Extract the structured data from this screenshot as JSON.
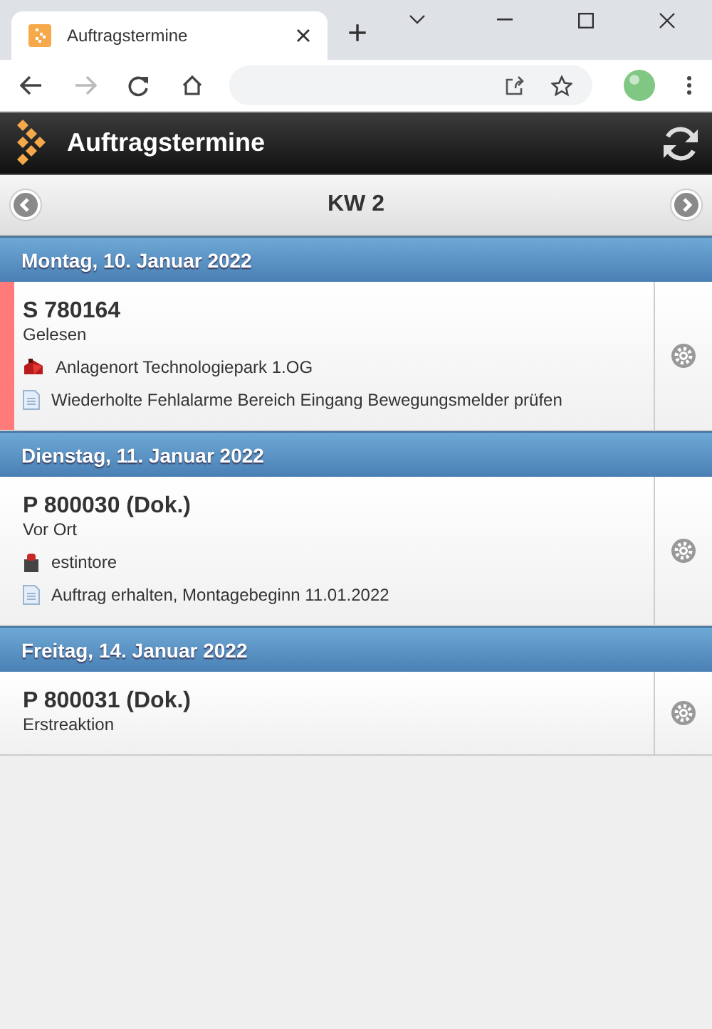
{
  "browser": {
    "tab_title": "Auftragstermine",
    "new_tab": "+"
  },
  "app": {
    "title": "Auftragstermine"
  },
  "week": {
    "label": "KW 2"
  },
  "days": [
    {
      "date": "Montag, 10. Januar 2022",
      "entries": [
        {
          "number": "S 780164",
          "status": "Gelesen",
          "flagged": true,
          "details": [
            {
              "kind": "location",
              "text": "Anlagenort Technologiepark 1.OG"
            },
            {
              "kind": "note",
              "text": "Wiederholte Fehlalarme Bereich Eingang Bewegungsmelder prüfen"
            }
          ]
        }
      ]
    },
    {
      "date": "Dienstag, 11. Januar 2022",
      "entries": [
        {
          "number": "P 800030 (Dok.)",
          "status": "Vor Ort",
          "flagged": false,
          "details": [
            {
              "kind": "device",
              "text": "estintore"
            },
            {
              "kind": "note",
              "text": "Auftrag erhalten, Montagebeginn 11.01.2022"
            }
          ]
        }
      ]
    },
    {
      "date": "Freitag, 14. Januar 2022",
      "entries": [
        {
          "number": "P 800031 (Dok.)",
          "status": "Erstreaktion",
          "flagged": false
        }
      ]
    }
  ]
}
